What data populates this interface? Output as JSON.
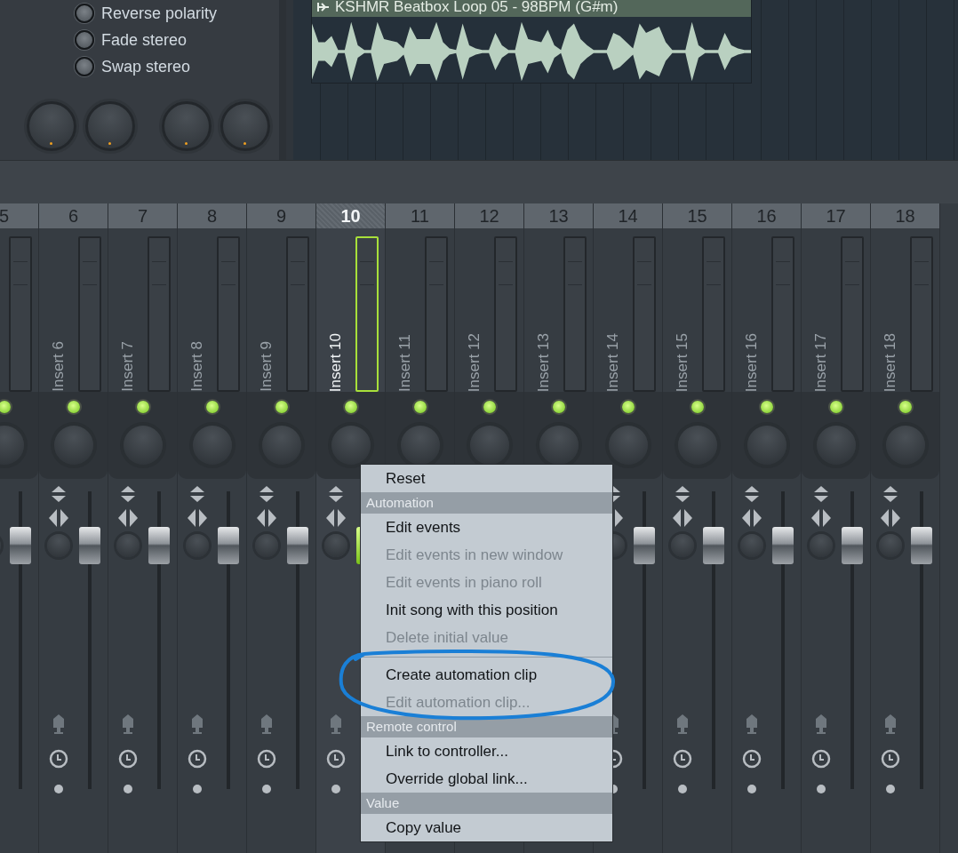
{
  "effect_panel": {
    "options": [
      {
        "label": "Reverse polarity",
        "on": false
      },
      {
        "label": "Fade stereo",
        "on": false
      },
      {
        "label": "Swap stereo",
        "on": false
      }
    ]
  },
  "playlist": {
    "clip": {
      "title": "KSHMR Beatbox Loop 05 - 98BPM (G#m)"
    }
  },
  "mixer": {
    "tracks": [
      {
        "number": "5",
        "selected": false
      },
      {
        "number": "6",
        "label": "Insert 6",
        "selected": false
      },
      {
        "number": "7",
        "label": "Insert 7",
        "selected": false
      },
      {
        "number": "8",
        "label": "Insert 8",
        "selected": false
      },
      {
        "number": "9",
        "label": "Insert 9",
        "selected": false
      },
      {
        "number": "10",
        "label": "Insert 10",
        "selected": true
      },
      {
        "number": "11",
        "label": "Insert 11",
        "selected": false
      },
      {
        "number": "12",
        "label": "Insert 12",
        "selected": false
      },
      {
        "number": "13",
        "label": "Insert 13",
        "selected": false
      },
      {
        "number": "14",
        "label": "Insert 14",
        "selected": false
      },
      {
        "number": "15",
        "label": "Insert 15",
        "selected": false
      },
      {
        "number": "16",
        "label": "Insert 16",
        "selected": false
      },
      {
        "number": "17",
        "label": "Insert 17",
        "selected": false
      },
      {
        "number": "18",
        "label": "Insert 18",
        "selected": false
      }
    ]
  },
  "context_menu": {
    "items": [
      {
        "kind": "item",
        "label": "Reset",
        "disabled": false
      },
      {
        "kind": "header",
        "label": "Automation"
      },
      {
        "kind": "item",
        "label": "Edit events",
        "disabled": false
      },
      {
        "kind": "item",
        "label": "Edit events in new window",
        "disabled": true
      },
      {
        "kind": "item",
        "label": "Edit events in piano roll",
        "disabled": true
      },
      {
        "kind": "item",
        "label": "Init song with this position",
        "disabled": false
      },
      {
        "kind": "item",
        "label": "Delete initial value",
        "disabled": true
      },
      {
        "kind": "separator"
      },
      {
        "kind": "item",
        "label": "Create automation clip",
        "disabled": false
      },
      {
        "kind": "item",
        "label": "Edit automation clip...",
        "disabled": true
      },
      {
        "kind": "header",
        "label": "Remote control"
      },
      {
        "kind": "item",
        "label": "Link to controller...",
        "disabled": false
      },
      {
        "kind": "item",
        "label": "Override global link...",
        "disabled": false
      },
      {
        "kind": "header",
        "label": "Value"
      },
      {
        "kind": "item",
        "label": "Copy value",
        "disabled": false
      }
    ]
  }
}
